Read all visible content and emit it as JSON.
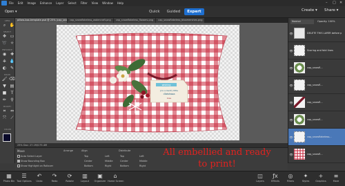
{
  "menu": {
    "items": [
      "File",
      "Edit",
      "Image",
      "Enhance",
      "Layer",
      "Select",
      "Filter",
      "View",
      "Window",
      "Help"
    ],
    "window_controls": [
      "–",
      "□",
      "✕"
    ]
  },
  "topbar": {
    "open_label": "Open",
    "modes": [
      "Quick",
      "Guided",
      "Expert"
    ],
    "active_mode": "Expert",
    "create_label": "Create",
    "share_label": "Share"
  },
  "doc_tabs": [
    "pillow-box-template.psd @ 25% (cap_snowflakeless_stem.png, RGB/8)",
    "cap_snowflakeless_watercraft.png",
    "cap_snowflakeless_flowers.png",
    "cap_snowflakeless_bloomershes.png"
  ],
  "toolbar": {
    "sections": [
      "VIEW",
      "SELECT",
      "ENHANCE",
      "DRAW",
      "MODIFY",
      "COLOR"
    ]
  },
  "status": {
    "text": "25%   Doc: 27.1M/175.4M"
  },
  "layers_panel": {
    "blend_mode": "Normal",
    "opacity_label": "Opacity:",
    "opacity_value": "100%",
    "layers": [
      {
        "name": "DELETE THIS LAYER before printing",
        "thumb": "note",
        "selected": false
      },
      {
        "name": "Scoring and fold lines",
        "thumb": "frame",
        "selected": false
      },
      {
        "name": "cap_snowfl...",
        "thumb": "flower",
        "selected": false
      },
      {
        "name": "cap_snowfl...",
        "thumb": "frame",
        "selected": false
      },
      {
        "name": "cap_snowfl...",
        "thumb": "ribbon",
        "selected": false
      },
      {
        "name": "cap_snowfl...",
        "thumb": "flower",
        "selected": false
      },
      {
        "name": "cap_snowflakeless...",
        "thumb": "frame",
        "selected": true
      },
      {
        "name": "cap_snowfl...",
        "thumb": "gingham",
        "selected": false
      }
    ]
  },
  "tool_options": {
    "move_label": "Move",
    "auto_select": "Auto Select Layer",
    "show_bounding": "Show Bounding Box",
    "show_highlight": "Show Highlight on Rollover",
    "arrange_label": "Arrange",
    "align_label": "Align",
    "distribute_label": "Distribute",
    "align_items": [
      "Top",
      "Left",
      "Center",
      "Middle",
      "Bottom",
      "Right"
    ],
    "distribute_items": [
      "Top",
      "Left",
      "Center",
      "Middle",
      "Bottom",
      "Right"
    ]
  },
  "caption": {
    "line1": "All embellied and ready",
    "line2": "to print!",
    "color": "#e2221f"
  },
  "taskbar": {
    "left": [
      {
        "icon": "photo-bin-icon",
        "label": "Photo Bin"
      },
      {
        "icon": "tool-options-icon",
        "label": "Tool Options"
      },
      {
        "icon": "undo-icon",
        "label": "Undo"
      },
      {
        "icon": "redo-icon",
        "label": "Redo"
      },
      {
        "icon": "rotate-icon",
        "label": "Rotate"
      },
      {
        "icon": "layout-icon",
        "label": "Layout"
      },
      {
        "icon": "organizer-icon",
        "label": "Organizer"
      },
      {
        "icon": "home-screen-icon",
        "label": "Home Screen"
      }
    ],
    "right": [
      {
        "icon": "layers-icon",
        "label": "Layers"
      },
      {
        "icon": "effects-icon",
        "label": "Effects"
      },
      {
        "icon": "filters-icon",
        "label": "Filters"
      },
      {
        "icon": "styles-icon",
        "label": "Styles"
      },
      {
        "icon": "graphics-icon",
        "label": "Graphics"
      },
      {
        "icon": "more-icon",
        "label": "More"
      }
    ]
  },
  "artwork": {
    "tag_text_1": "wishing",
    "tag_text_2": "you a merry little",
    "tag_text_3": "christmas",
    "tag_text_4": "love",
    "gingham_color": "#c8283c"
  }
}
